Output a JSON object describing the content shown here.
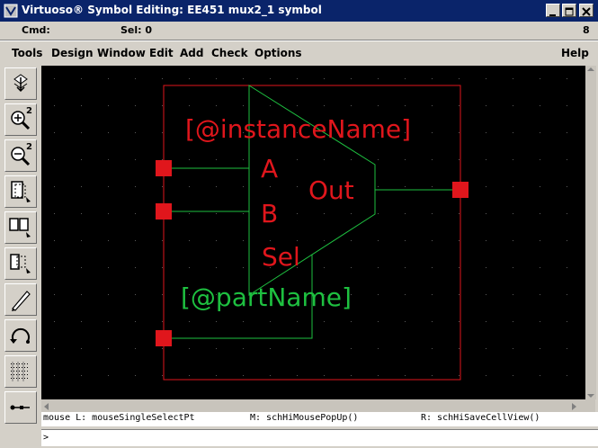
{
  "window": {
    "title": "Virtuoso® Symbol Editing: EE451 mux2_1 symbol",
    "controls": [
      "minimize",
      "maximize",
      "close"
    ]
  },
  "status": {
    "cmd_label": "Cmd:",
    "sel_label": "Sel: 0",
    "right_value": "8"
  },
  "menu": {
    "items": [
      "Tools",
      "Design",
      "Window",
      "Edit",
      "Add",
      "Check",
      "Options"
    ],
    "help": "Help"
  },
  "toolbar": {
    "icons": [
      "save-icon",
      "zoom-in-2-icon",
      "zoom-out-2-icon",
      "select-area-icon",
      "multi-select-icon",
      "partial-select-icon",
      "edit-pen-icon",
      "undo-arc-icon",
      "ruler-dots-icon",
      "pin-wire-icon"
    ]
  },
  "symbol": {
    "instance_name_label": "[@instanceName]",
    "part_name_label": "[@partName]",
    "pins": {
      "a": "A",
      "b": "B",
      "sel": "Sel",
      "out": "Out"
    },
    "colors": {
      "red": "#e0161c",
      "green": "#1ec040",
      "background": "#000000"
    }
  },
  "mousebar": {
    "left": "mouse L: mouseSingleSelectPt",
    "middle": "M: schHiMousePopUp()",
    "right": "R: schHiSaveCellView()"
  },
  "cmdline": {
    "prompt": ">"
  }
}
